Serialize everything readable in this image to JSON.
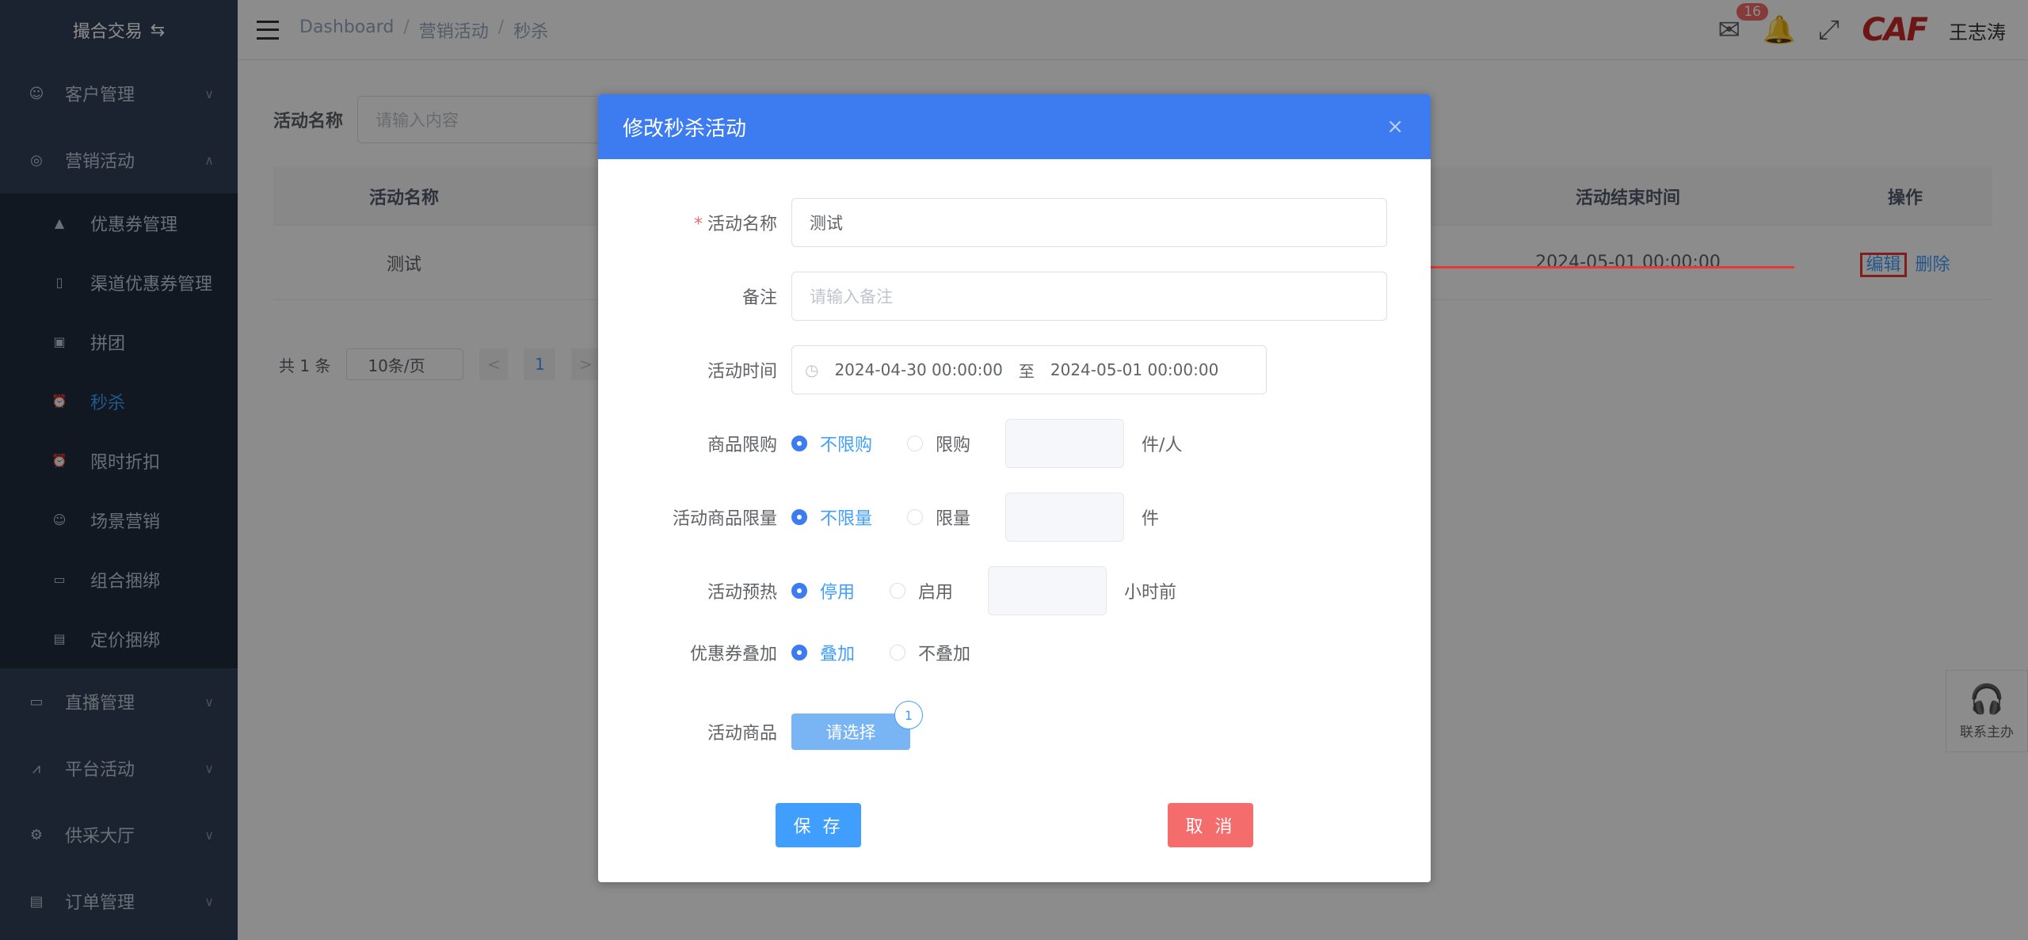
{
  "sidebar": {
    "title": "撮合交易",
    "menus": [
      {
        "label": "客户管理",
        "icon": "user-icon"
      },
      {
        "label": "营销活动",
        "icon": "compass-icon"
      }
    ],
    "sub_items": [
      {
        "label": "优惠券管理",
        "icon": "lock-icon"
      },
      {
        "label": "渠道优惠券管理",
        "icon": "tablet-icon"
      },
      {
        "label": "拼团",
        "icon": "box-icon"
      },
      {
        "label": "秒杀",
        "icon": "alarm-clock-icon"
      },
      {
        "label": "限时折扣",
        "icon": "alarm-clock-icon"
      },
      {
        "label": "场景营销",
        "icon": "smile-icon"
      },
      {
        "label": "组合捆绑",
        "icon": "bag-icon"
      },
      {
        "label": "定价捆绑",
        "icon": "receipt-icon"
      }
    ],
    "bottom_menus": [
      {
        "label": "直播管理",
        "icon": "video-camera-icon"
      },
      {
        "label": "平台活动",
        "icon": "chart-icon"
      },
      {
        "label": "供采大厅",
        "icon": "gear-icon"
      },
      {
        "label": "订单管理",
        "icon": "document-icon"
      }
    ]
  },
  "header": {
    "breadcrumb": [
      "Dashboard",
      "营销活动",
      "秒杀"
    ],
    "mail_count": "16",
    "logo_text": "CAF",
    "username": "王志涛"
  },
  "main": {
    "search_label": "活动名称",
    "search_placeholder": "请输入内容",
    "table": {
      "headers": {
        "name": "活动名称",
        "end_time": "活动结束时间",
        "ops": "操作"
      },
      "row": {
        "name": "测试",
        "end_time": "2024-05-01 00:00:00",
        "edit": "编辑",
        "delete": "删除"
      }
    },
    "pager": {
      "total": "共 1 条",
      "page_size": "10条/页",
      "prev": "<",
      "page": "1",
      "next": ">"
    },
    "contact_label": "联系主办"
  },
  "dialog": {
    "title": "修改秒杀活动",
    "close": "×",
    "fields": {
      "name_label": "活动名称",
      "name_value": "测试",
      "remark_label": "备注",
      "remark_placeholder": "请输入备注",
      "time_label": "活动时间",
      "time_start": "2024-04-30 00:00:00",
      "time_sep": "至",
      "time_end": "2024-05-01 00:00:00",
      "limit_label": "商品限购",
      "limit_opt1": "不限购",
      "limit_opt2": "限购",
      "limit_unit": "件/人",
      "qty_label": "活动商品限量",
      "qty_opt1": "不限量",
      "qty_opt2": "限量",
      "qty_unit": "件",
      "preheat_label": "活动预热",
      "preheat_opt1": "停用",
      "preheat_opt2": "启用",
      "preheat_unit": "小时前",
      "coupon_label": "优惠券叠加",
      "coupon_opt1": "叠加",
      "coupon_opt2": "不叠加",
      "goods_label": "活动商品",
      "goods_button": "请选择",
      "goods_count": "1"
    },
    "save": "保 存",
    "cancel": "取 消"
  }
}
